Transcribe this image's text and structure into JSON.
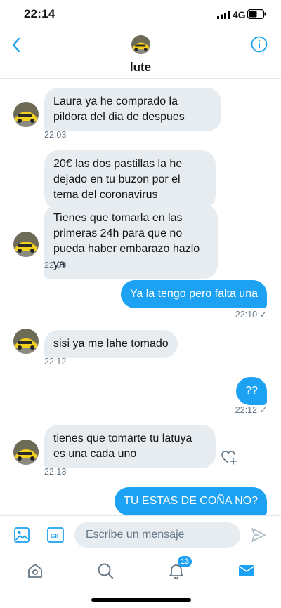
{
  "status_bar": {
    "time": "22:14",
    "network": "4G"
  },
  "header": {
    "contact_name": "lute"
  },
  "messages": [
    {
      "direction": "in",
      "text": "Laura ya he comprado la pildora del dia de despues",
      "time": "22:03"
    },
    {
      "direction": "in",
      "text": "20€ las dos pastillas la he dejado en tu buzon por el tema del coronavirus",
      "time": ""
    },
    {
      "direction": "in",
      "text": "Tienes que tomarla en las primeras 24h para que no pueda haber embarazo hazlo ya",
      "time": "22:09"
    },
    {
      "direction": "out",
      "text": "Ya la tengo pero falta una",
      "time": "22:10 ✓"
    },
    {
      "direction": "in",
      "text": "sisi ya me lahe tomado",
      "time": "22:12"
    },
    {
      "direction": "out",
      "text": "??",
      "time": "22:12 ✓"
    },
    {
      "direction": "in",
      "text": "tienes que tomarte tu latuya es una cada uno",
      "time": "22:13"
    },
    {
      "direction": "out",
      "text": "TU ESTAS DE COÑA NO?",
      "time": ""
    }
  ],
  "composer": {
    "gif_label": "GIF",
    "placeholder": "Escribe un mensaje"
  },
  "tabbar": {
    "notifications_count": "13"
  },
  "colors": {
    "accent": "#1da1f2",
    "incoming_bubble": "#e6ecf0",
    "muted_text": "#657786"
  },
  "icons": [
    "back-chevron-icon",
    "info-icon",
    "image-icon",
    "gif-icon",
    "send-icon",
    "home-icon",
    "search-icon",
    "bell-icon",
    "mail-icon",
    "heart-add-icon"
  ]
}
